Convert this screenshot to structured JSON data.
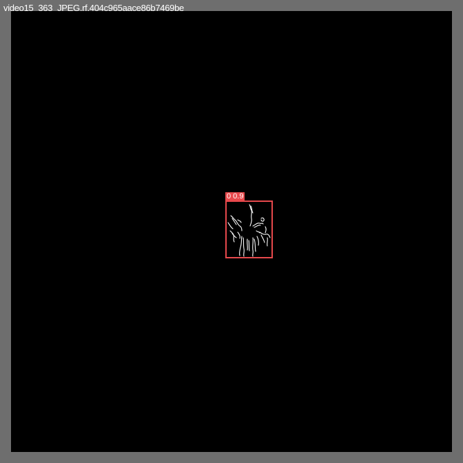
{
  "window": {
    "filename": "video15_363_JPEG.rf.404c965aace86b7469be"
  },
  "colors": {
    "border": "#6e6e6e",
    "canvas": "#000000",
    "bbox": "#e8494c",
    "edges": "#ffffff"
  },
  "detections": [
    {
      "label": "0 0.9",
      "class_id": "0",
      "confidence": 0.9
    }
  ]
}
